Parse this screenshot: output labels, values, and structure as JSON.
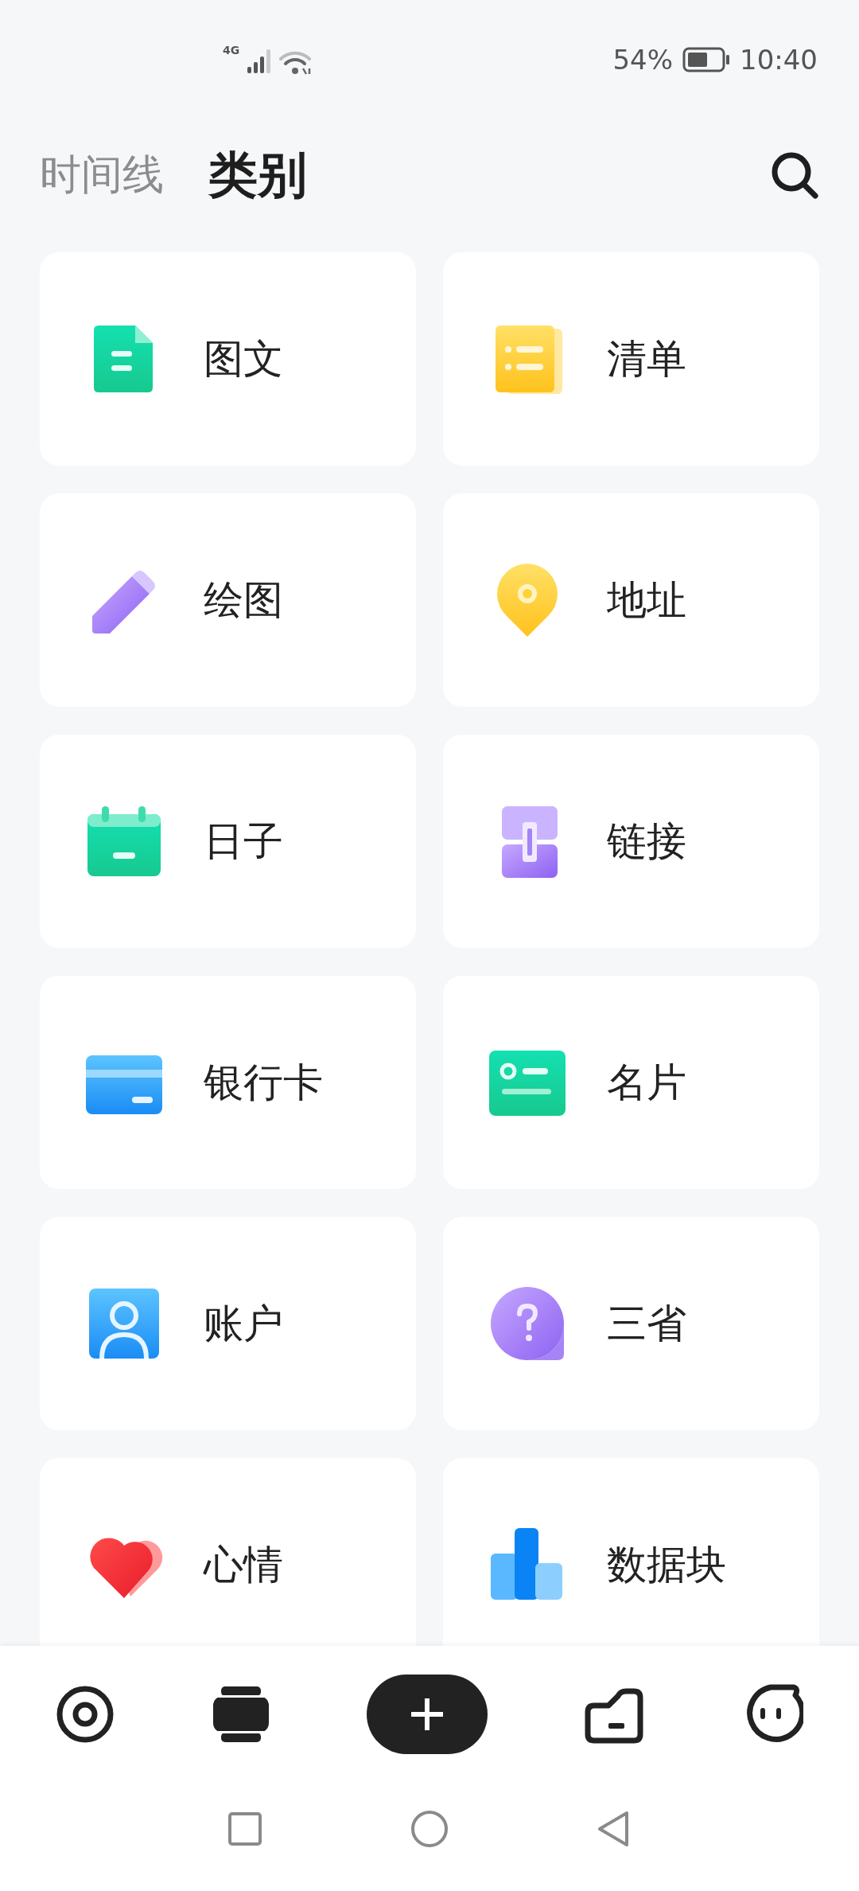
{
  "status_bar": {
    "network": "4G",
    "battery": "54%",
    "time": "10:40"
  },
  "tabs": [
    {
      "label": "时间线",
      "selected": false
    },
    {
      "label": "类别",
      "selected": true
    }
  ],
  "categories": [
    {
      "label": "图文"
    },
    {
      "label": "清单"
    },
    {
      "label": "绘图"
    },
    {
      "label": "地址"
    },
    {
      "label": "日子"
    },
    {
      "label": "链接"
    },
    {
      "label": "银行卡"
    },
    {
      "label": "名片"
    },
    {
      "label": "账户"
    },
    {
      "label": "三省"
    },
    {
      "label": "心情"
    },
    {
      "label": "数据块"
    }
  ]
}
